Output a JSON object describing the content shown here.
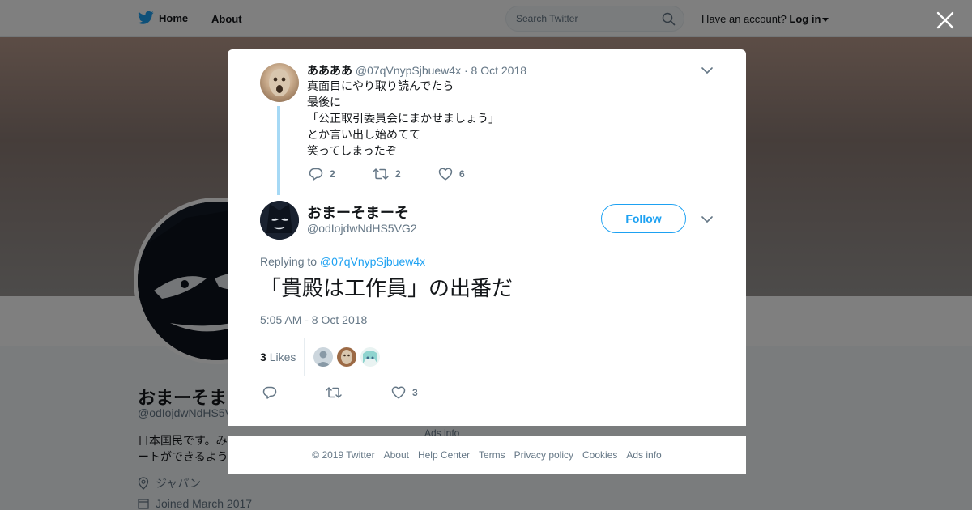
{
  "topbar": {
    "home_label": "Home",
    "about_label": "About",
    "search_placeholder": "Search Twitter",
    "have_account": "Have an account?",
    "login_label": "Log in"
  },
  "profile": {
    "name": "おまーそま",
    "handle": "@odIojdwNdHS5V",
    "bio_line1": "日本国民です。み",
    "bio_line2": "ートができるよう",
    "location": "ジャパン",
    "joined": "Joined March 2017",
    "ads_info": "Ads info"
  },
  "parent_tweet": {
    "name": "ああああ",
    "handle": "@07qVnypSjbuew4x",
    "separator": "·",
    "date": "8 Oct 2018",
    "lines": [
      "真面目にやり取り読んでたら",
      "最後に",
      "「公正取引委員会にまかせましょう」",
      "とか言い出し始めてて",
      "笑ってしまったぞ"
    ],
    "reply_count": "2",
    "retweet_count": "2",
    "like_count": "6"
  },
  "main_tweet": {
    "name": "おまーそまーそ",
    "handle": "@odIojdwNdHS5VG2",
    "follow_label": "Follow",
    "replying_prefix": "Replying to",
    "replying_to": "@07qVnypSjbuew4x",
    "text": "「貴殿は工作員」の出番だ",
    "timestamp": "5:05 AM - 8 Oct 2018",
    "likes_count": "3",
    "likes_label": "Likes",
    "like_count": "3"
  },
  "footer": {
    "copyright": "© 2019 Twitter",
    "about": "About",
    "help": "Help Center",
    "terms": "Terms",
    "privacy": "Privacy policy",
    "cookies": "Cookies",
    "ads": "Ads info"
  },
  "colors": {
    "accent": "#1da1f2",
    "thread_line": "#a6d9f5",
    "muted_text": "#657786"
  }
}
